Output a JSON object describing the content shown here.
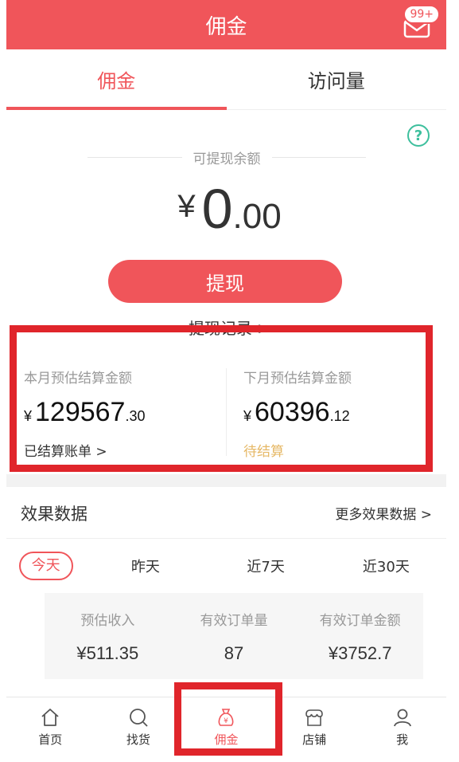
{
  "header": {
    "title": "佣金",
    "mail_badge": "99+"
  },
  "tabs": [
    {
      "label": "佣金",
      "active": true
    },
    {
      "label": "访问量",
      "active": false
    }
  ],
  "balance": {
    "label": "可提现余额",
    "currency": "¥",
    "integer": "0",
    "decimal": ".00",
    "withdraw_button": "提现",
    "record_link": "提现记录 >"
  },
  "estimate": {
    "this_month": {
      "title": "本月预估结算金额",
      "currency": "¥",
      "integer": "129567",
      "decimal": ".30",
      "link": "已结算账单 >"
    },
    "next_month": {
      "title": "下月预估结算金额",
      "currency": "¥",
      "integer": "60396",
      "decimal": ".12",
      "status": "待结算"
    }
  },
  "effect": {
    "title": "效果数据",
    "more": "更多效果数据 >",
    "periods": [
      "今天",
      "昨天",
      "近7天",
      "近30天"
    ],
    "active_period": "今天",
    "stats": [
      {
        "label": "预估收入",
        "value": "¥511.35"
      },
      {
        "label": "有效订单量",
        "value": "87"
      },
      {
        "label": "有效订单金额",
        "value": "¥3752.7"
      }
    ]
  },
  "bottom_nav": [
    {
      "label": "首页",
      "icon": "home-icon",
      "active": false
    },
    {
      "label": "找货",
      "icon": "search-icon",
      "active": false
    },
    {
      "label": "佣金",
      "icon": "money-bag-icon",
      "active": true
    },
    {
      "label": "店铺",
      "icon": "shop-icon",
      "active": false
    },
    {
      "label": "我",
      "icon": "user-icon",
      "active": false
    }
  ],
  "colors": {
    "accent": "#f0555a",
    "highlight_box": "#e0252b",
    "help": "#3dbf9d",
    "pending": "#e6b866"
  }
}
